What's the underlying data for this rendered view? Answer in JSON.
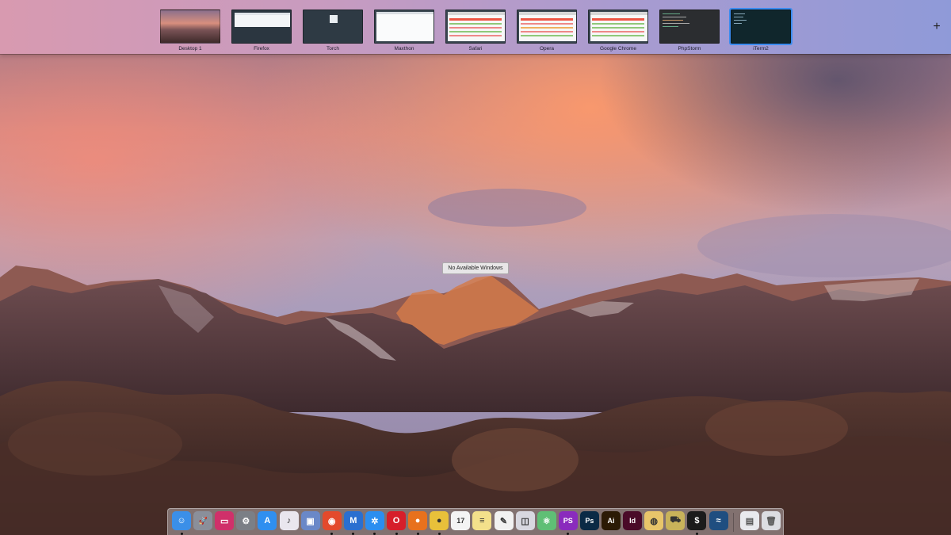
{
  "spaces": [
    {
      "label": "Desktop 1",
      "active": false
    },
    {
      "label": "Firefox",
      "active": false
    },
    {
      "label": "Torch",
      "active": false
    },
    {
      "label": "Maxthon",
      "active": false
    },
    {
      "label": "Safari",
      "active": false
    },
    {
      "label": "Opera",
      "active": false
    },
    {
      "label": "Google Chrome",
      "active": false
    },
    {
      "label": "PhpStorm",
      "active": false
    },
    {
      "label": "iTerm2",
      "active": true
    }
  ],
  "add_space_symbol": "+",
  "center_message": "No Available Windows",
  "dock": {
    "apps": [
      {
        "name": "finder-icon",
        "glyph": "☺",
        "color": "#3b8fe8",
        "running": true
      },
      {
        "name": "launchpad-icon",
        "glyph": "🚀",
        "color": "#8a8f9a",
        "running": false
      },
      {
        "name": "display-icon",
        "glyph": "▭",
        "color": "#d0306a",
        "running": false
      },
      {
        "name": "system-preferences-icon",
        "glyph": "⚙",
        "color": "#7b7f86",
        "running": false
      },
      {
        "name": "app-store-icon",
        "glyph": "A",
        "color": "#2f8ff0",
        "running": false
      },
      {
        "name": "itunes-icon",
        "glyph": "♪",
        "color": "#e9e6ee",
        "running": false
      },
      {
        "name": "preview-icon",
        "glyph": "▣",
        "color": "#6a88c8",
        "running": false
      },
      {
        "name": "torch-icon",
        "glyph": "◉",
        "color": "#e34a2c",
        "running": true
      },
      {
        "name": "maxthon-icon",
        "glyph": "M",
        "color": "#2a6fd0",
        "running": true
      },
      {
        "name": "safari-icon",
        "glyph": "✲",
        "color": "#2b8ef0",
        "running": true
      },
      {
        "name": "opera-icon",
        "glyph": "O",
        "color": "#d61e2a",
        "running": true
      },
      {
        "name": "firefox-icon",
        "glyph": "●",
        "color": "#e8711d",
        "running": true
      },
      {
        "name": "chrome-icon",
        "glyph": "●",
        "color": "#e8c03a",
        "running": true
      },
      {
        "name": "calendar-icon",
        "glyph": "17",
        "color": "#f4f4f4",
        "running": false
      },
      {
        "name": "notes-icon",
        "glyph": "≡",
        "color": "#f3e08b",
        "running": false
      },
      {
        "name": "textedit-icon",
        "glyph": "✎",
        "color": "#f1f1f1",
        "running": false
      },
      {
        "name": "preview-viewer-icon",
        "glyph": "◫",
        "color": "#d8d8e0",
        "running": false
      },
      {
        "name": "atom-icon",
        "glyph": "⚛",
        "color": "#5fbf75",
        "running": false
      },
      {
        "name": "phpstorm-icon",
        "glyph": "PS",
        "color": "#8a2bbd",
        "running": true
      },
      {
        "name": "photoshop-icon",
        "glyph": "Ps",
        "color": "#0b2a45",
        "running": false
      },
      {
        "name": "illustrator-icon",
        "glyph": "Ai",
        "color": "#2b1a05",
        "running": false
      },
      {
        "name": "indesign-icon",
        "glyph": "Id",
        "color": "#4a0a28",
        "running": false
      },
      {
        "name": "sequel-pro-icon",
        "glyph": "◍",
        "color": "#e8c56a",
        "running": false
      },
      {
        "name": "transmit-icon",
        "glyph": "⛟",
        "color": "#c8b25a",
        "running": false
      },
      {
        "name": "terminal-icon",
        "glyph": "$",
        "color": "#1b1b1b",
        "running": true
      },
      {
        "name": "mysql-workbench-icon",
        "glyph": "≈",
        "color": "#1f4e80",
        "running": false
      }
    ],
    "stack_items": [
      {
        "name": "documents-stack-icon",
        "glyph": "▤",
        "color": "#e9eaee"
      },
      {
        "name": "trash-icon",
        "glyph": "🗑",
        "color": "#dcdde2"
      }
    ]
  }
}
